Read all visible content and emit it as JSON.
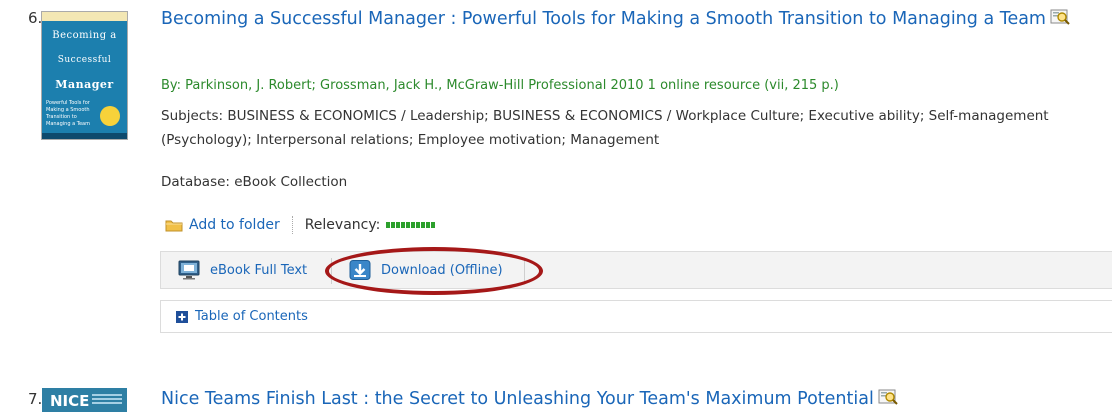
{
  "results": [
    {
      "number": "6.",
      "cover": {
        "title_line1": "Becoming a",
        "title_line2": "Successful",
        "title_line3": "Manager",
        "subtitle": "Powerful Tools for Making a Smooth Transition to Managing a Team"
      },
      "title": "Becoming a Successful Manager : Powerful Tools for Making a Smooth Transition to Managing a Team",
      "byline": "By: Parkinson, J. Robert; Grossman, Jack H., McGraw-Hill Professional 2010 1 online resource (vii, 215 p.)",
      "subjects": "Subjects: BUSINESS & ECONOMICS / Leadership; BUSINESS & ECONOMICS / Workplace Culture; Executive ability; Self-management (Psychology); Interpersonal relations; Employee motivation; Management",
      "database": "Database: eBook Collection",
      "add_to_folder": "Add to folder",
      "relevancy_label": "Relevancy:",
      "relevancy_level": 1.0,
      "links": {
        "ebook_full_text": "eBook Full Text",
        "download_offline": "Download (Offline)"
      },
      "table_of_contents": "Table of Contents"
    },
    {
      "number": "7.",
      "cover": {
        "title_line1": "NICE"
      },
      "title": "Nice Teams Finish Last : the Secret to Unleashing Your Team's Maximum Potential"
    }
  ],
  "icons": {
    "preview": "magnifier-preview-icon",
    "folder": "folder-icon",
    "ebook": "ebook-monitor-icon",
    "download": "download-icon",
    "expand": "plus-box-icon"
  },
  "colors": {
    "link": "#1a66b8",
    "byline": "#2c8a2c",
    "relevancy": "#2ca02c",
    "highlight": "#a51818",
    "cover6": "#1c7fae"
  }
}
